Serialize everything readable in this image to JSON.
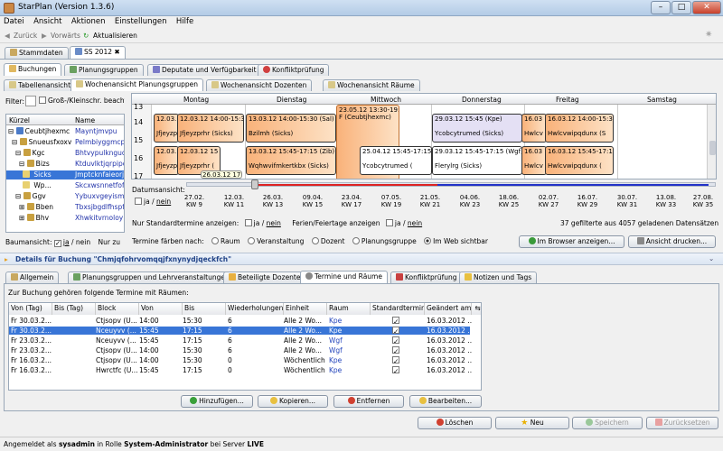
{
  "window": {
    "title": "StarPlan (Version 1.3.6)"
  },
  "menu": [
    "Datei",
    "Ansicht",
    "Aktionen",
    "Einstellungen",
    "Hilfe"
  ],
  "nav": {
    "back": "Zurück",
    "forward": "Vorwärts",
    "refresh": "Aktualisieren"
  },
  "top_tabs": [
    "Stammdaten",
    "SS 2012"
  ],
  "sub_tabs": [
    "Buchungen",
    "Planungsgruppen",
    "Deputate und Verfügbarkeit",
    "Konfliktprüfung"
  ],
  "view_tabs": [
    "Tabellenansicht",
    "Wochenansicht Planungsgruppen",
    "Wochenansicht Dozenten",
    "Wochenansicht Räume"
  ],
  "filter": {
    "label": "Filter:",
    "checkbox": "Groß-/Kleinschr. beachten"
  },
  "tree": {
    "headers": [
      "Kürzel",
      "Name"
    ],
    "rows": [
      {
        "k": "Ceubtjhexmc",
        "n": "Mayntjmvpu"
      },
      {
        "k": "Snueusfxoxv",
        "n": "Pelmbiyggmcpen"
      },
      {
        "k": "Kgc",
        "n": "Bhtvypulknguqu"
      },
      {
        "k": "Bizs",
        "n": "Ktduvlktjqrpipo"
      },
      {
        "k": "Sicks",
        "n": "Jmptcknfaieorj"
      },
      {
        "k": "Wp...",
        "n": "Skcxwsnnetfofk"
      },
      {
        "k": "Ggv",
        "n": "Yybuxvgeyismsj"
      },
      {
        "k": "Bben",
        "n": "Tbxsjbgdlfhspf"
      },
      {
        "k": "Bhv",
        "n": "Xhwkitvrnoloy"
      }
    ],
    "baum_label": "Baumansicht:",
    "baum_ja": "ja",
    "baum_nein": "nein",
    "nur": "Nur zu"
  },
  "week": {
    "days": [
      "Montag",
      "Dienstag",
      "Mittwoch",
      "Donnerstag",
      "Freitag",
      "Samstag"
    ],
    "hours": [
      "13",
      "14",
      "15",
      "16",
      "17"
    ],
    "events": [
      {
        "t1": "12.03.12 1",
        "t2": "Jfjeyzp"
      },
      {
        "t1": "12.03.12 14:00-15:30 (Sal)",
        "t2": "Jfjeyzprhr (Sicks)"
      },
      {
        "t1": "13.03.12 14:00-15:30 (Sal)",
        "t2": "Bzilmh (Sicks)"
      },
      {
        "t1": "23.05.12 13:30-19:00 (",
        "t2": "F (Ceubtjhexmc)"
      },
      {
        "t1": "29.03.12 15:45 (Kpe)",
        "t2": "Ycobcytrumed (Sicks)"
      },
      {
        "t1": "16.03",
        "t2": "Hwlcv"
      },
      {
        "t1": "16.03.12 14:00-15:30",
        "t2": "Hwlcvwipqdunx (S"
      },
      {
        "t1": "12.03.12 1",
        "t2": "Jfjeyzp"
      },
      {
        "t1": "12.03.12 15",
        "t2": "Jfjeyzprhr ("
      },
      {
        "t1": "13.03.12 15:45-17:15 (Zib)",
        "t2": "Wqhwvifmkertkbx (Sicks)"
      },
      {
        "t1": "25.04.12 15:45-17:15 (",
        "t2": "Ycobcytrumed ("
      },
      {
        "t1": "29.03.12 15:45-17:15 (Wgf)",
        "t2": "Flerylrg (Sicks)"
      },
      {
        "t1": "16.03",
        "t2": "Hwlcv"
      },
      {
        "t1": "16.03.12 15:45-17:15",
        "t2": "Hwlcvwipqdunx ("
      },
      {
        "t1": "26.03.12 17:00",
        "t2": ""
      }
    ],
    "datum_label": "Datumsansicht:",
    "ja": "ja",
    "nein": "nein",
    "timeline": [
      {
        "d": "27.02.",
        "kw": "KW 9"
      },
      {
        "d": "12.03.",
        "kw": "KW 11"
      },
      {
        "d": "26.03.",
        "kw": "KW 13"
      },
      {
        "d": "09.04.",
        "kw": "KW 15"
      },
      {
        "d": "23.04.",
        "kw": "KW 17"
      },
      {
        "d": "07.05.",
        "kw": "KW 19"
      },
      {
        "d": "21.05.",
        "kw": "KW 21"
      },
      {
        "d": "04.06.",
        "kw": "KW 23"
      },
      {
        "d": "18.06.",
        "kw": "KW 25"
      },
      {
        "d": "02.07.",
        "kw": "KW 27"
      },
      {
        "d": "16.07.",
        "kw": "KW 29"
      },
      {
        "d": "30.07.",
        "kw": "KW 31"
      },
      {
        "d": "13.08.",
        "kw": "KW 33"
      },
      {
        "d": "27.08.",
        "kw": "KW 35"
      }
    ],
    "std_label": "Nur Standardtermine anzeigen:",
    "ferien_label": "Ferien/Feiertage anzeigen",
    "count": "37 gefilterte aus 4057 geladenen Datensätzen",
    "faerben_label": "Termine färben nach:",
    "faerben_opts": [
      "Raum",
      "Veranstaltung",
      "Dozent",
      "Planungsgruppe",
      "Im Web sichtbar"
    ],
    "browser_btn": "Im Browser anzeigen...",
    "druck_btn": "Ansicht drucken..."
  },
  "details": {
    "title": "Details für Buchung \"Chmjqfohrvomqqjfxnynydjqeckfch\"",
    "tabs": [
      "Allgemein",
      "Planungsgruppen und Lehrveranstaltungen",
      "Beteiligte Dozenten",
      "Termine und Räume",
      "Konfliktprüfung",
      "Notizen und Tags"
    ],
    "intro": "Zur Buchung gehören folgende Termine mit Räumen:",
    "headers": [
      "Von (Tag)",
      "Bis (Tag)",
      "Block",
      "Von",
      "Bis",
      "Wiederholungen",
      "Einheit",
      "Raum",
      "Standardtermin",
      "Geändert am"
    ],
    "rows": [
      [
        "Fr 30.03.2...",
        "",
        "Ctjsopv (U...",
        "14:00",
        "15:30",
        "6",
        "Alle 2 Wo...",
        "Kpe",
        "✓",
        "16.03.2012 ..."
      ],
      [
        "Fr 30.03.2...",
        "",
        "Nceuyvv (...",
        "15:45",
        "17:15",
        "6",
        "Alle 2 Wo...",
        "Kpe",
        "✓",
        "16.03.2012 ..."
      ],
      [
        "Fr 23.03.2...",
        "",
        "Nceuyvv (...",
        "15:45",
        "17:15",
        "6",
        "Alle 2 Wo...",
        "Wgf",
        "✓",
        "16.03.2012 ..."
      ],
      [
        "Fr 23.03.2...",
        "",
        "Ctjsopv (U...",
        "14:00",
        "15:30",
        "6",
        "Alle 2 Wo...",
        "Wgf",
        "✓",
        "16.03.2012 ..."
      ],
      [
        "Fr 16.03.2...",
        "",
        "Ctjsopv (U...",
        "14:00",
        "15:30",
        "0",
        "Wöchentlich",
        "Kpe",
        "✓",
        "16.03.2012 ..."
      ],
      [
        "Fr 16.03.2...",
        "",
        "Hwrctfc (U...",
        "15:45",
        "17:15",
        "0",
        "Wöchentlich",
        "Kpe",
        "✓",
        "16.03.2012 ..."
      ]
    ],
    "buttons": [
      "Hinzufügen...",
      "Kopieren...",
      "Entfernen",
      "Bearbeiten..."
    ]
  },
  "footer": {
    "buttons": [
      "Löschen",
      "Neu",
      "Speichern",
      "Zurücksetzen"
    ]
  },
  "status": {
    "pre": "Angemeldet als ",
    "user": "sysadmin",
    "mid": " in Rolle ",
    "role": "System-Administrator",
    "post": " bei Server ",
    "server": "LIVE"
  }
}
